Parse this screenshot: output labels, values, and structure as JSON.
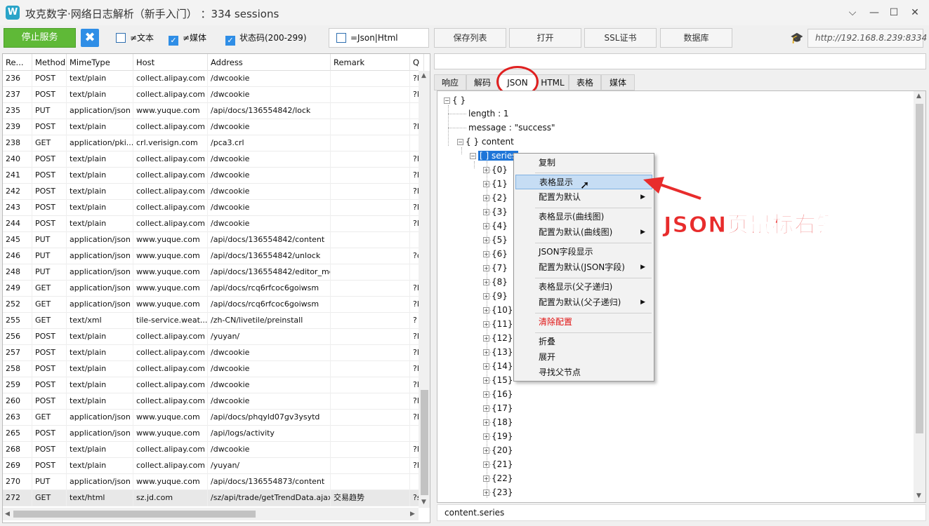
{
  "window": {
    "app_icon": "W",
    "title": "攻克数字·网络日志解析（新手入门） ：334 sessions",
    "controls": [
      "chevron-down",
      "minimize",
      "maximize",
      "close"
    ]
  },
  "toolbar": {
    "stop_label": "停止服务",
    "clear_icon": "✖",
    "chk_not_text": "≠文本",
    "chk_not_media": "≠媒体",
    "chk_status": "状态码(200-299)",
    "chk_json_html": "=Json|Html",
    "save_list": "保存列表",
    "open": "打开",
    "ssl_cert": "SSL证书",
    "database": "数据库",
    "url": "http://192.168.8.239:8334"
  },
  "table": {
    "headers": [
      "Re...",
      "Method",
      "MimeType",
      "Host",
      "Address",
      "Remark",
      "Q"
    ],
    "rows": [
      [
        "236",
        "POST",
        "text/plain",
        "collect.alipay.com",
        "/dwcookie",
        "",
        "?l"
      ],
      [
        "237",
        "POST",
        "text/plain",
        "collect.alipay.com",
        "/dwcookie",
        "",
        "?l"
      ],
      [
        "235",
        "PUT",
        "application/json",
        "www.yuque.com",
        "/api/docs/136554842/lock",
        "",
        ""
      ],
      [
        "239",
        "POST",
        "text/plain",
        "collect.alipay.com",
        "/dwcookie",
        "",
        "?l"
      ],
      [
        "238",
        "GET",
        "application/pki...",
        "crl.verisign.com",
        "/pca3.crl",
        "",
        ""
      ],
      [
        "240",
        "POST",
        "text/plain",
        "collect.alipay.com",
        "/dwcookie",
        "",
        "?l"
      ],
      [
        "241",
        "POST",
        "text/plain",
        "collect.alipay.com",
        "/dwcookie",
        "",
        "?l"
      ],
      [
        "242",
        "POST",
        "text/plain",
        "collect.alipay.com",
        "/dwcookie",
        "",
        "?l"
      ],
      [
        "243",
        "POST",
        "text/plain",
        "collect.alipay.com",
        "/dwcookie",
        "",
        "?l"
      ],
      [
        "244",
        "POST",
        "text/plain",
        "collect.alipay.com",
        "/dwcookie",
        "",
        "?l"
      ],
      [
        "245",
        "PUT",
        "application/json",
        "www.yuque.com",
        "/api/docs/136554842/content",
        "",
        ""
      ],
      [
        "246",
        "PUT",
        "application/json",
        "www.yuque.com",
        "/api/docs/136554842/unlock",
        "",
        "?c"
      ],
      [
        "248",
        "PUT",
        "application/json",
        "www.yuque.com",
        "/api/docs/136554842/editor_meta",
        "",
        ""
      ],
      [
        "249",
        "GET",
        "application/json",
        "www.yuque.com",
        "/api/docs/rcq6rfcoc6goiwsm",
        "",
        "?l"
      ],
      [
        "252",
        "GET",
        "application/json",
        "www.yuque.com",
        "/api/docs/rcq6rfcoc6goiwsm",
        "",
        "?l"
      ],
      [
        "255",
        "GET",
        "text/xml",
        "tile-service.weat...",
        "/zh-CN/livetile/preinstall",
        "",
        "?"
      ],
      [
        "256",
        "POST",
        "text/plain",
        "collect.alipay.com",
        "/yuyan/",
        "",
        "?l"
      ],
      [
        "257",
        "POST",
        "text/plain",
        "collect.alipay.com",
        "/dwcookie",
        "",
        "?l"
      ],
      [
        "258",
        "POST",
        "text/plain",
        "collect.alipay.com",
        "/dwcookie",
        "",
        "?l"
      ],
      [
        "259",
        "POST",
        "text/plain",
        "collect.alipay.com",
        "/dwcookie",
        "",
        "?l"
      ],
      [
        "260",
        "POST",
        "text/plain",
        "collect.alipay.com",
        "/dwcookie",
        "",
        "?l"
      ],
      [
        "263",
        "GET",
        "application/json",
        "www.yuque.com",
        "/api/docs/phqyld07gv3ysytd",
        "",
        "?l"
      ],
      [
        "265",
        "POST",
        "application/json",
        "www.yuque.com",
        "/api/logs/activity",
        "",
        ""
      ],
      [
        "268",
        "POST",
        "text/plain",
        "collect.alipay.com",
        "/dwcookie",
        "",
        "?l"
      ],
      [
        "269",
        "POST",
        "text/plain",
        "collect.alipay.com",
        "/yuyan/",
        "",
        "?l"
      ],
      [
        "270",
        "PUT",
        "application/json",
        "www.yuque.com",
        "/api/docs/136554873/content",
        "",
        ""
      ],
      [
        "272",
        "GET",
        "text/html",
        "sz.jd.com",
        "/sz/api/trade/getTrendData.ajax",
        "交易趋势",
        "?s"
      ]
    ]
  },
  "tabs": [
    "响应",
    "解码",
    "JSON",
    "HTML",
    "表格",
    "媒体"
  ],
  "tree": {
    "root": "{ }",
    "length": "length : 1",
    "message": "message : \"success\"",
    "content": "{ } content",
    "series": "[ ] series",
    "items": [
      "{0}",
      "{1}",
      "{2}",
      "{3}",
      "{4}",
      "{5}",
      "{6}",
      "{7}",
      "{8}",
      "{9}",
      "{10}",
      "{11}",
      "{12}",
      "{13}",
      "{14}",
      "{15}",
      "{16}",
      "{17}",
      "{18}",
      "{19}",
      "{20}",
      "{21}",
      "{22}",
      "{23}"
    ]
  },
  "status_path": "content.series",
  "context_menu": {
    "copy": "复制",
    "table_show": "表格显示",
    "config_default": "配置为默认",
    "table_show_curve": "表格显示(曲线图)",
    "config_default_curve": "配置为默认(曲线图)",
    "json_field_show": "JSON字段显示",
    "config_default_json": "配置为默认(JSON字段)",
    "table_show_recursive": "表格显示(父子递归)",
    "config_default_recursive": "配置为默认(父子递归)",
    "clear_config": "清除配置",
    "collapse": "折叠",
    "expand": "展开",
    "find_parent": "寻找父节点"
  },
  "annotation": "JSON页鼠标右键",
  "colors": {
    "accent_green": "#5fb937",
    "accent_blue": "#2f8ee6",
    "selection_blue": "#1e75d8",
    "annotation_red": "#e82c2c"
  }
}
